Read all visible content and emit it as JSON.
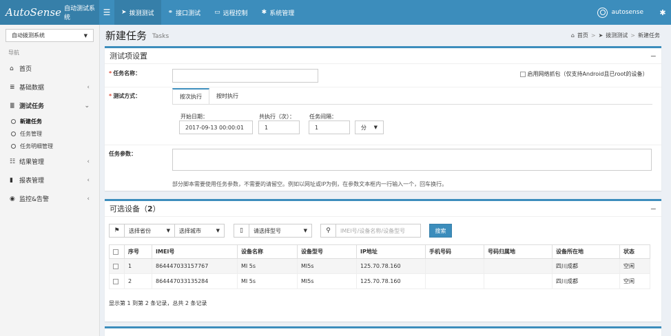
{
  "topbar": {
    "brand": "AutoSense",
    "brand_sub": "自动测试系统",
    "menu_icon": "☰",
    "nav": [
      {
        "label": "拨测测试",
        "icon": "send-icon",
        "glyph": "➤"
      },
      {
        "label": "接口测试",
        "icon": "link-icon",
        "glyph": "⚭"
      },
      {
        "label": "远程控制",
        "icon": "monitor-icon",
        "glyph": "▭"
      },
      {
        "label": "系统管理",
        "icon": "gears-icon",
        "glyph": "✱"
      }
    ],
    "user": "autosense",
    "settings_glyph": "✱",
    "accent": "#3c8dbc"
  },
  "sidebar": {
    "system_select": "自动拨测系统",
    "header": "导航",
    "items": [
      {
        "label": "首页",
        "glyph": "⌂"
      },
      {
        "label": "基础数据",
        "glyph": "≣",
        "arrow": "‹"
      },
      {
        "label": "测试任务",
        "glyph": "≣",
        "arrow": "⌄"
      },
      {
        "label": "结果管理",
        "glyph": "☷",
        "arrow": "‹"
      },
      {
        "label": "报表管理",
        "glyph": "▮",
        "arrow": "‹"
      },
      {
        "label": "监控&告警",
        "glyph": "◉",
        "arrow": "‹"
      }
    ],
    "subitems": [
      "新建任务",
      "任务管理",
      "任务明细管理"
    ]
  },
  "page": {
    "title": "新建任务",
    "subtitle": "Tasks",
    "breadcrumb": [
      "首页",
      "拨测测试",
      "新建任务"
    ],
    "breadcrumb_sep": ">"
  },
  "settings_box": {
    "title": "测试项设置",
    "collapse": "−",
    "task_name_label": "任务名称：",
    "task_name_value": "",
    "capture_label": "启用网络抓包（仅支持Android且已root的设备）",
    "mode_label": "测试方式：",
    "tabs": [
      "按次执行",
      "按时执行"
    ],
    "start_date_label": "开始日期：",
    "start_date_value": "2017-09-13 00:00:01",
    "times_label": "共执行（次）：",
    "times_value": "1",
    "interval_label": "任务间隔：",
    "interval_value": "1",
    "interval_unit": "分",
    "params_label": "任务参数：",
    "params_value": "",
    "hint": "部分脚本需要使用任务参数，不需要的请留空。例如以网址或IP为例，在参数文本框内一行输入一个，回车换行。",
    "required_mark": "*"
  },
  "devices_box": {
    "title_prefix": "可选设备（",
    "count": "2",
    "title_suffix": "）",
    "collapse": "−",
    "province_placeholder": "选择省份",
    "city_placeholder": "选择城市",
    "model_placeholder": "请选择型号",
    "search_placeholder": "IMEI号/设备名称/设备型号",
    "search_button": "搜索",
    "columns": [
      "序号",
      "IMEI号",
      "设备名称",
      "设备型号",
      "IP地址",
      "手机号码",
      "号码归属地",
      "设备所在地",
      "状态"
    ],
    "rows": [
      [
        "1",
        "864447033157767",
        "MI 5s",
        "MI5s",
        "125.70.78.160",
        "",
        "",
        "四川成都",
        "空闲"
      ],
      [
        "2",
        "864447033135284",
        "MI 5s",
        "MI5s",
        "125.70.78.160",
        "",
        "",
        "四川成都",
        "空闲"
      ]
    ],
    "pagination": "显示第 1 到第 2 条记录，总共 2 条记录"
  }
}
